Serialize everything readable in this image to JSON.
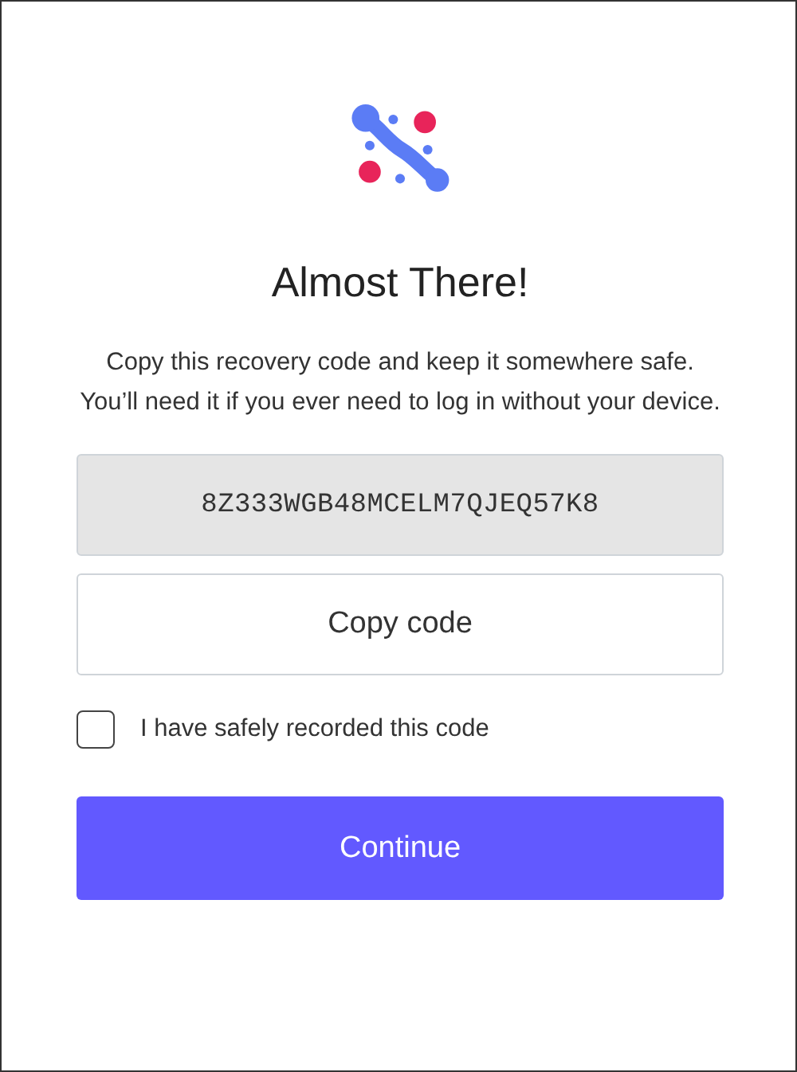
{
  "title": "Almost There!",
  "message": "Copy this recovery code and keep it somewhere safe. You’ll need it if you ever need to log in without your device.",
  "recovery_code": "8Z333WGB48MCELM7QJEQ57K8",
  "copy_button": "Copy code",
  "confirm_checkbox": {
    "label": "I have safely recorded this code",
    "checked": false
  },
  "continue_button": "Continue"
}
